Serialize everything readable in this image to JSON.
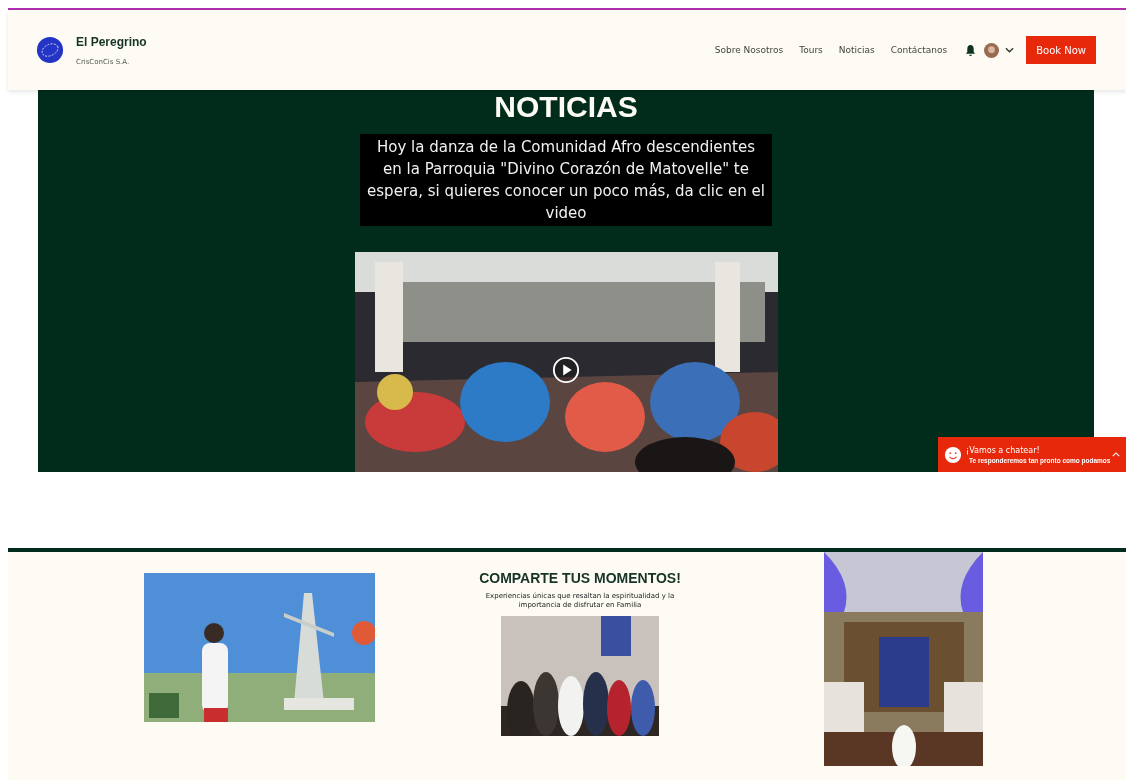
{
  "header": {
    "brand": "El Peregrino",
    "company": "CrisConCis S.A.",
    "nav": [
      {
        "label": "Sobre Nosotros",
        "selected": false
      },
      {
        "label": "Tours",
        "selected": false
      },
      {
        "label": "Noticias",
        "selected": false
      },
      {
        "label": "Contáctanos",
        "selected": false
      }
    ],
    "cta": "Book Now"
  },
  "news": {
    "title": "NOTICIAS",
    "text": "Hoy la danza de la Comunidad Afro descendientes en la Parroquia \"Divino Corazón de Matovelle\" te espera, si quieres conocer un poco más, da clic en el video"
  },
  "chat": {
    "title": "¡Vamos a chatear!",
    "subtitle": "Te responderemos tan pronto como podamos"
  },
  "moments": {
    "title": "COMPARTE TUS MOMENTOS!",
    "caption": "Experiencias únicas que resaltan la espiritualidad y la importancia de disfrutar en Familia"
  }
}
